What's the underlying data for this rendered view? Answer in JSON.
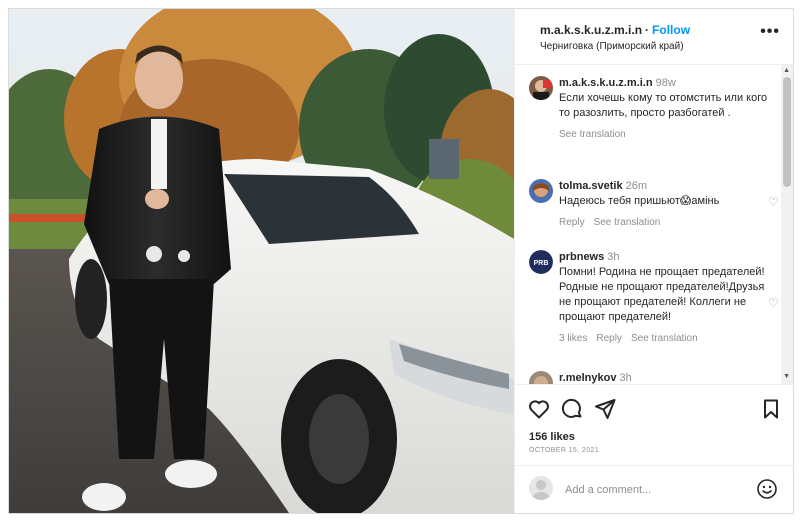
{
  "post": {
    "username": "m.a.k.s.k.u.z.m.i.n",
    "follow_label": "Follow",
    "location": "Черниговка (Приморский край)",
    "more_label": "•••"
  },
  "comments": [
    {
      "name": "m.a.k.s.k.u.z.m.i.n",
      "time": "98w",
      "text": "Если хочешь кому то отомстить или кого то разозлить, просто разбогатей .",
      "see_translation": "See translation"
    },
    {
      "name": "tolma.svetik",
      "time": "26m",
      "text": "Надеюсь тебя пришьют😱амінь",
      "reply": "Reply",
      "see_translation": "See translation"
    },
    {
      "name": "prbnews",
      "time": "3h",
      "text": "Помни! Родина не прощает предателей! Родные не прощают предателей!Друзья не прощают предателей! Коллеги не прощают предателей!",
      "likes": "3 likes",
      "reply": "Reply",
      "see_translation": "See translation"
    },
    {
      "name": "r.melnykov",
      "time": "3h"
    }
  ],
  "likes_text": "156 likes",
  "date_text": "OCTOBER 15, 2021",
  "add_comment_placeholder": "Add a comment...",
  "icons": {
    "like": "heart-icon",
    "comment": "comment-icon",
    "share": "send-icon",
    "save": "bookmark-icon",
    "emoji": "emoji-icon",
    "more": "more-icon"
  },
  "colors": {
    "accent": "#0095f6",
    "muted": "#8e8e8e",
    "text": "#262626"
  }
}
